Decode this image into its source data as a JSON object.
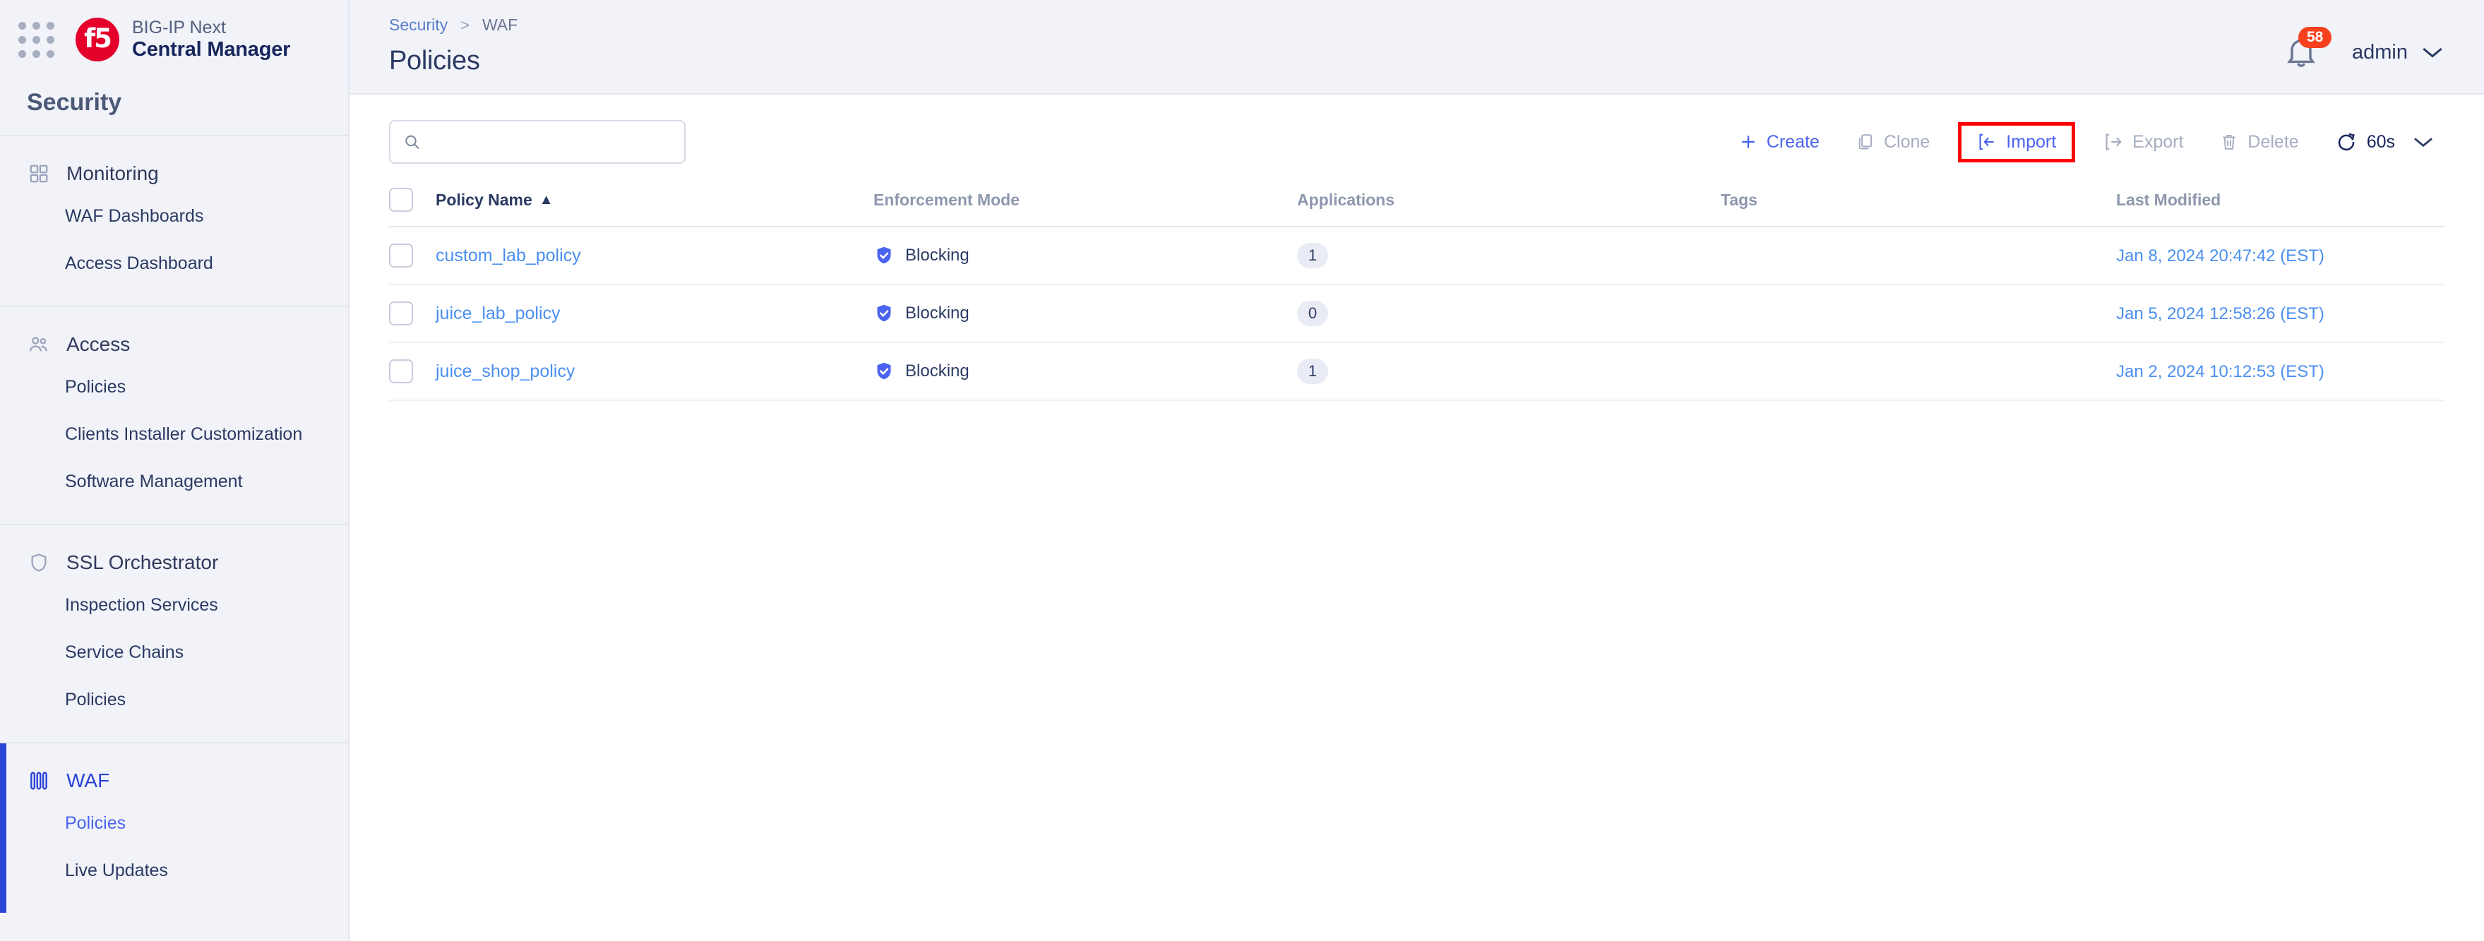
{
  "brand": {
    "line1": "BIG-IP Next",
    "line2": "Central Manager",
    "logo_text": "f5",
    "logo_color": "#e4002b"
  },
  "sidebar": {
    "section_title": "Security",
    "groups": [
      {
        "label": "Monitoring",
        "icon": "grid-squares-icon",
        "active": false,
        "items": [
          {
            "label": "WAF Dashboards",
            "selected": false
          },
          {
            "label": "Access Dashboard",
            "selected": false
          }
        ]
      },
      {
        "label": "Access",
        "icon": "users-icon",
        "active": false,
        "items": [
          {
            "label": "Policies",
            "selected": false
          },
          {
            "label": "Clients Installer Customization",
            "selected": false
          },
          {
            "label": "Software Management",
            "selected": false
          }
        ]
      },
      {
        "label": "SSL Orchestrator",
        "icon": "shield-icon",
        "active": false,
        "items": [
          {
            "label": "Inspection Services",
            "selected": false
          },
          {
            "label": "Service Chains",
            "selected": false
          },
          {
            "label": "Policies",
            "selected": false
          }
        ]
      },
      {
        "label": "WAF",
        "icon": "firewall-icon",
        "active": true,
        "items": [
          {
            "label": "Policies",
            "selected": true
          },
          {
            "label": "Live Updates",
            "selected": false
          }
        ]
      }
    ]
  },
  "header": {
    "breadcrumb": {
      "parent": "Security",
      "separator": ">",
      "current": "WAF"
    },
    "title": "Policies",
    "notifications_count": "58",
    "user_name": "admin"
  },
  "search": {
    "value": "",
    "placeholder": ""
  },
  "toolbar": {
    "create_label": "Create",
    "clone_label": "Clone",
    "import_label": "Import",
    "export_label": "Export",
    "delete_label": "Delete",
    "refresh_interval": "60s",
    "highlight_color": "#fe0000",
    "accent_color": "#4a63f0",
    "disabled_color": "#a6adc0"
  },
  "table": {
    "columns": [
      {
        "label": "Policy Name",
        "sorted": true,
        "sort_dir": "asc"
      },
      {
        "label": "Enforcement Mode",
        "sorted": false
      },
      {
        "label": "Applications",
        "sorted": false
      },
      {
        "label": "Tags",
        "sorted": false
      },
      {
        "label": "Last Modified",
        "sorted": false
      }
    ],
    "rows": [
      {
        "name": "custom_lab_policy",
        "enforcement": "Blocking",
        "applications": "1",
        "tags": "",
        "last_modified": "Jan 8, 2024 20:47:42 (EST)"
      },
      {
        "name": "juice_lab_policy",
        "enforcement": "Blocking",
        "applications": "0",
        "tags": "",
        "last_modified": "Jan 5, 2024 12:58:26 (EST)"
      },
      {
        "name": "juice_shop_policy",
        "enforcement": "Blocking",
        "applications": "1",
        "tags": "",
        "last_modified": "Jan 2, 2024 10:12:53 (EST)"
      }
    ]
  }
}
